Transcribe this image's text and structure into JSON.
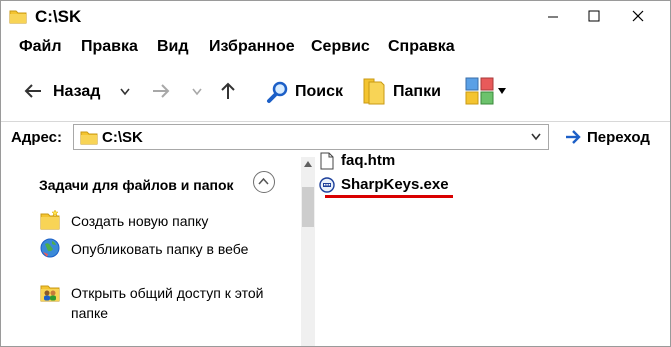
{
  "window": {
    "title": "C:\\SK"
  },
  "menu": {
    "items": [
      "Файл",
      "Правка",
      "Вид",
      "Избранное",
      "Сервис",
      "Справка"
    ]
  },
  "toolbar": {
    "back_label": "Назад",
    "search_label": "Поиск",
    "folders_label": "Папки"
  },
  "address": {
    "label": "Адрес:",
    "value": "C:\\SK",
    "go_label": "Переход"
  },
  "tasks": {
    "header": "Задачи для файлов и папок",
    "items": [
      {
        "label": "Создать новую папку",
        "icon": "new-folder-icon"
      },
      {
        "label": "Опубликовать папку в вебе",
        "icon": "publish-web-icon"
      },
      {
        "label": "Открыть общий доступ к этой папке",
        "icon": "share-folder-icon"
      }
    ]
  },
  "files": [
    {
      "name": "faq.htm",
      "icon": "document-icon"
    },
    {
      "name": "SharpKeys.exe",
      "icon": "application-icon"
    }
  ],
  "colors": {
    "folder": "#f4c430",
    "accent_blue": "#1c5fc7",
    "highlight_red": "#d90000"
  }
}
